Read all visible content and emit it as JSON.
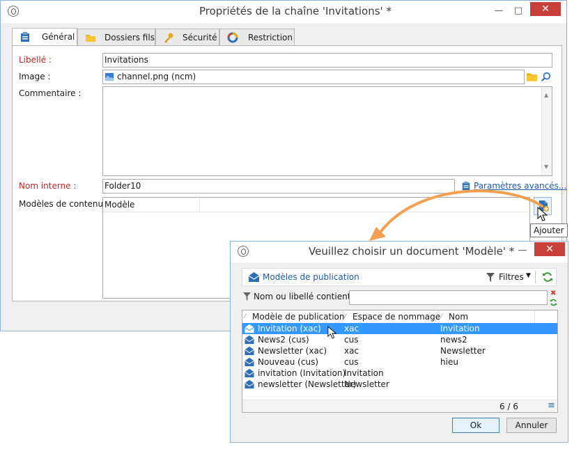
{
  "main_window": {
    "title": "Propriétés de la chaîne 'Invitations' *",
    "tabs": [
      {
        "label": "Général"
      },
      {
        "label": "Dossiers fils"
      },
      {
        "label": "Sécurité"
      },
      {
        "label": "Restriction"
      }
    ],
    "form": {
      "label_label": "Libellé :",
      "label_value": "Invitations",
      "image_label": "Image :",
      "image_value": "channel.png (ncm)",
      "comment_label": "Commentaire :",
      "internal_name_label": "Nom interne :",
      "internal_name_value": "Folder10",
      "advanced_link": "Paramètres avancés...",
      "content_models_label": "Modèles de contenu :",
      "content_models_col": "Modèle"
    },
    "tooltip": "Ajouter"
  },
  "dialog": {
    "title": "Veuillez choisir un document 'Modèle' *",
    "folder_label": "Modèles de publication",
    "filters_label": "Filtres",
    "search_label": "Nom ou libellé contient :",
    "search_value": "",
    "columns": [
      "Modèle de publication",
      "Espace de nommage",
      "Nom"
    ],
    "rows": [
      {
        "model": "Invitation (xac)",
        "ns": "xac",
        "name": "Invitation",
        "selected": true
      },
      {
        "model": "News2 (cus)",
        "ns": "cus",
        "name": "news2",
        "selected": false
      },
      {
        "model": "Newsletter (xac)",
        "ns": "xac",
        "name": "Newsletter",
        "selected": false
      },
      {
        "model": "Nouveau (cus)",
        "ns": "cus",
        "name": "hieu",
        "selected": false
      },
      {
        "model": "invitation (Invitation)",
        "ns": "Invitation",
        "name": "",
        "selected": false
      },
      {
        "model": "newsletter (Newsletter)",
        "ns": "Newsletter",
        "name": "",
        "selected": false
      }
    ],
    "count": "6 / 6",
    "ok_label": "Ok",
    "cancel_label": "Annuler"
  },
  "colors": {
    "accent": "#3399ff",
    "required": "#c0262d",
    "link": "#1f5aa8",
    "arrow": "#f0a050",
    "close": "#c7403b"
  }
}
